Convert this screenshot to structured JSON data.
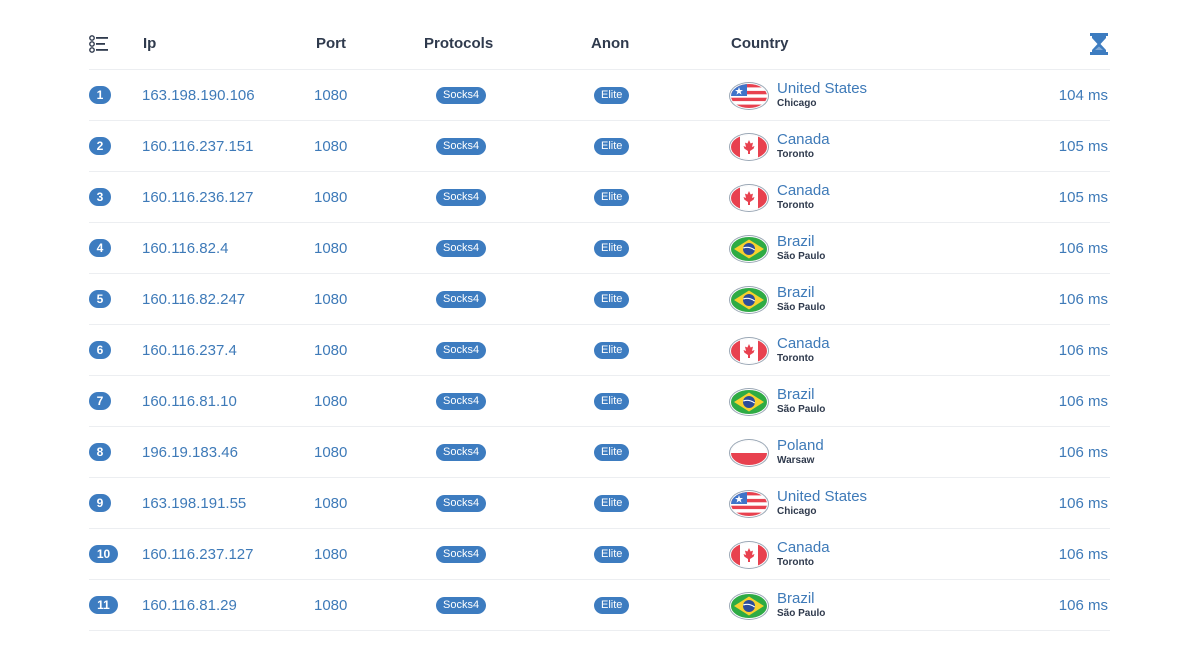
{
  "header": {
    "ip": "Ip",
    "port": "Port",
    "protocols": "Protocols",
    "anon": "Anon",
    "country": "Country",
    "list_icon": "list-icon",
    "ping_icon": "hourglass-icon"
  },
  "colors": {
    "accent": "#3d7cc0",
    "link_text": "#3e7ab8",
    "header_text": "#2f3a4d"
  },
  "rows": [
    {
      "num": "1",
      "ip": "163.198.190.106",
      "port": "1080",
      "protocol": "Socks4",
      "anon": "Elite",
      "country": "United States",
      "city": "Chicago",
      "flag": "us",
      "ping": "104 ms"
    },
    {
      "num": "2",
      "ip": "160.116.237.151",
      "port": "1080",
      "protocol": "Socks4",
      "anon": "Elite",
      "country": "Canada",
      "city": "Toronto",
      "flag": "ca",
      "ping": "105 ms"
    },
    {
      "num": "3",
      "ip": "160.116.236.127",
      "port": "1080",
      "protocol": "Socks4",
      "anon": "Elite",
      "country": "Canada",
      "city": "Toronto",
      "flag": "ca",
      "ping": "105 ms"
    },
    {
      "num": "4",
      "ip": "160.116.82.4",
      "port": "1080",
      "protocol": "Socks4",
      "anon": "Elite",
      "country": "Brazil",
      "city": "São Paulo",
      "flag": "br",
      "ping": "106 ms"
    },
    {
      "num": "5",
      "ip": "160.116.82.247",
      "port": "1080",
      "protocol": "Socks4",
      "anon": "Elite",
      "country": "Brazil",
      "city": "São Paulo",
      "flag": "br",
      "ping": "106 ms"
    },
    {
      "num": "6",
      "ip": "160.116.237.4",
      "port": "1080",
      "protocol": "Socks4",
      "anon": "Elite",
      "country": "Canada",
      "city": "Toronto",
      "flag": "ca",
      "ping": "106 ms"
    },
    {
      "num": "7",
      "ip": "160.116.81.10",
      "port": "1080",
      "protocol": "Socks4",
      "anon": "Elite",
      "country": "Brazil",
      "city": "São Paulo",
      "flag": "br",
      "ping": "106 ms"
    },
    {
      "num": "8",
      "ip": "196.19.183.46",
      "port": "1080",
      "protocol": "Socks4",
      "anon": "Elite",
      "country": "Poland",
      "city": "Warsaw",
      "flag": "pl",
      "ping": "106 ms"
    },
    {
      "num": "9",
      "ip": "163.198.191.55",
      "port": "1080",
      "protocol": "Socks4",
      "anon": "Elite",
      "country": "United States",
      "city": "Chicago",
      "flag": "us",
      "ping": "106 ms"
    },
    {
      "num": "10",
      "ip": "160.116.237.127",
      "port": "1080",
      "protocol": "Socks4",
      "anon": "Elite",
      "country": "Canada",
      "city": "Toronto",
      "flag": "ca",
      "ping": "106 ms"
    },
    {
      "num": "11",
      "ip": "160.116.81.29",
      "port": "1080",
      "protocol": "Socks4",
      "anon": "Elite",
      "country": "Brazil",
      "city": "São Paulo",
      "flag": "br",
      "ping": "106 ms"
    }
  ]
}
